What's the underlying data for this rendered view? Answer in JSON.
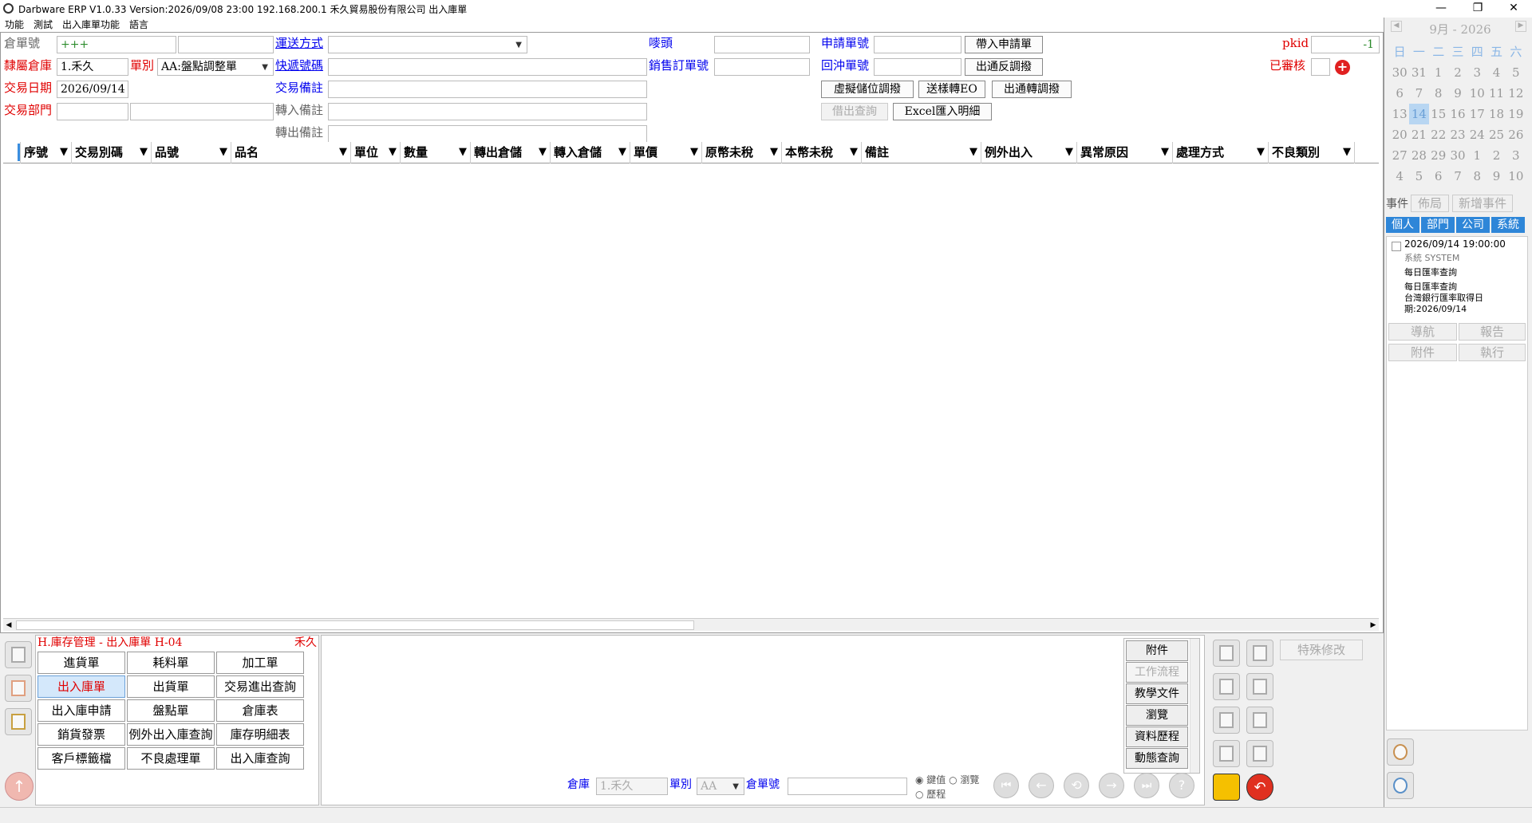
{
  "titlebar": {
    "title": "Darbware ERP V1.0.33 Version:2026/09/08 23:00    192.168.200.1 禾久貿易股份有限公司 出入庫單",
    "minimize": "—",
    "restore": "❐",
    "close": "✕"
  },
  "menu": [
    "功能",
    "測試",
    "出入庫單功能",
    "語言"
  ],
  "form": {
    "warehouse_no_label": "倉單號",
    "warehouse_no_value": "+++",
    "warehouse_label": "隸屬倉庫",
    "warehouse_value": "1.禾久",
    "type_label": "單別",
    "type_value": "AA:盤點調整單",
    "date_label": "交易日期",
    "date_value": "2026/09/14",
    "dept_label": "交易部門",
    "ship_label": "運送方式",
    "express_label": "快遞號碼",
    "trans_note_label": "交易備註",
    "in_note_label": "轉入備註",
    "out_note_label": "轉出備註",
    "mark_label": "嘜頭",
    "sales_order_label": "銷售訂單號",
    "apply_no_label": "申請單號",
    "reverse_no_label": "回沖單號",
    "pkid_label": "pkid",
    "pkid_value": "-1",
    "reviewed_label": "已審核"
  },
  "buttons": {
    "bring_apply": "帶入申請單",
    "pass_reverse": "出通反調撥",
    "virtual": "虛擬儲位調撥",
    "send_eo": "送樣轉EO",
    "pass_transfer": "出通轉調撥",
    "borrow_query": "借出查詢",
    "excel_import": "Excel匯入明細"
  },
  "grid": {
    "columns": [
      "序號",
      "交易別碼",
      "品號",
      "品名",
      "單位",
      "數量",
      "轉出倉儲",
      "轉入倉儲",
      "單價",
      "原幣未稅",
      "本幣未稅",
      "備註",
      "例外出入",
      "異常原因",
      "處理方式",
      "不良類別"
    ]
  },
  "module": {
    "title": "H.庫存管理 - 出入庫單  H-04",
    "company": "禾久"
  },
  "nav_buttons": [
    "進貨單",
    "耗料單",
    "加工單",
    "出入庫單",
    "出貨單",
    "交易進出查詢",
    "出入庫申請",
    "盤點單",
    "倉庫表",
    "銷貨發票",
    "例外出入庫查詢",
    "庫存明細表",
    "客戶標籤檔",
    "不良處理單",
    "出入庫查詢"
  ],
  "side_list": [
    "附件",
    "工作流程",
    "教學文件",
    "瀏覽",
    "資料歷程",
    "動態查詢"
  ],
  "special_edit": "特殊修改",
  "search": {
    "warehouse_label": "倉庫",
    "warehouse_value": "1.禾久",
    "type_label": "單別",
    "type_value": "AA",
    "no_label": "倉單號",
    "radio1": "鍵值",
    "radio2": "瀏覽",
    "radio3": "歷程"
  },
  "calendar": {
    "month": "9月",
    "year": "2026",
    "weekdays": [
      "日",
      "一",
      "二",
      "三",
      "四",
      "五",
      "六"
    ],
    "weeks": [
      [
        "30",
        "31",
        "1",
        "2",
        "3",
        "4",
        "5"
      ],
      [
        "6",
        "7",
        "8",
        "9",
        "10",
        "11",
        "12"
      ],
      [
        "13",
        "14",
        "15",
        "16",
        "17",
        "18",
        "19"
      ],
      [
        "20",
        "21",
        "22",
        "23",
        "24",
        "25",
        "26"
      ],
      [
        "27",
        "28",
        "29",
        "30",
        "1",
        "2",
        "3"
      ],
      [
        "4",
        "5",
        "6",
        "7",
        "8",
        "9",
        "10"
      ]
    ],
    "today": "14"
  },
  "events": {
    "label": "事件",
    "layout_btn": "佈局",
    "new_btn": "新增事件",
    "tabs": [
      "個人",
      "部門",
      "公司",
      "系統"
    ],
    "item": {
      "time": "2026/09/14 19:00:00",
      "source": "系統  SYSTEM",
      "line1": "每日匯率查詢",
      "line2": "每日匯率查詢",
      "line3": "台灣銀行匯率取得日",
      "line4": "期:2026/09/14"
    },
    "btn_nav": "導航",
    "btn_report": "報告",
    "btn_attach": "附件",
    "btn_exec": "執行"
  },
  "colors": {
    "red": "#e00000",
    "blue": "#0000ee",
    "accent": "#2e86d8",
    "selected_bg": "#d4e8fb"
  }
}
